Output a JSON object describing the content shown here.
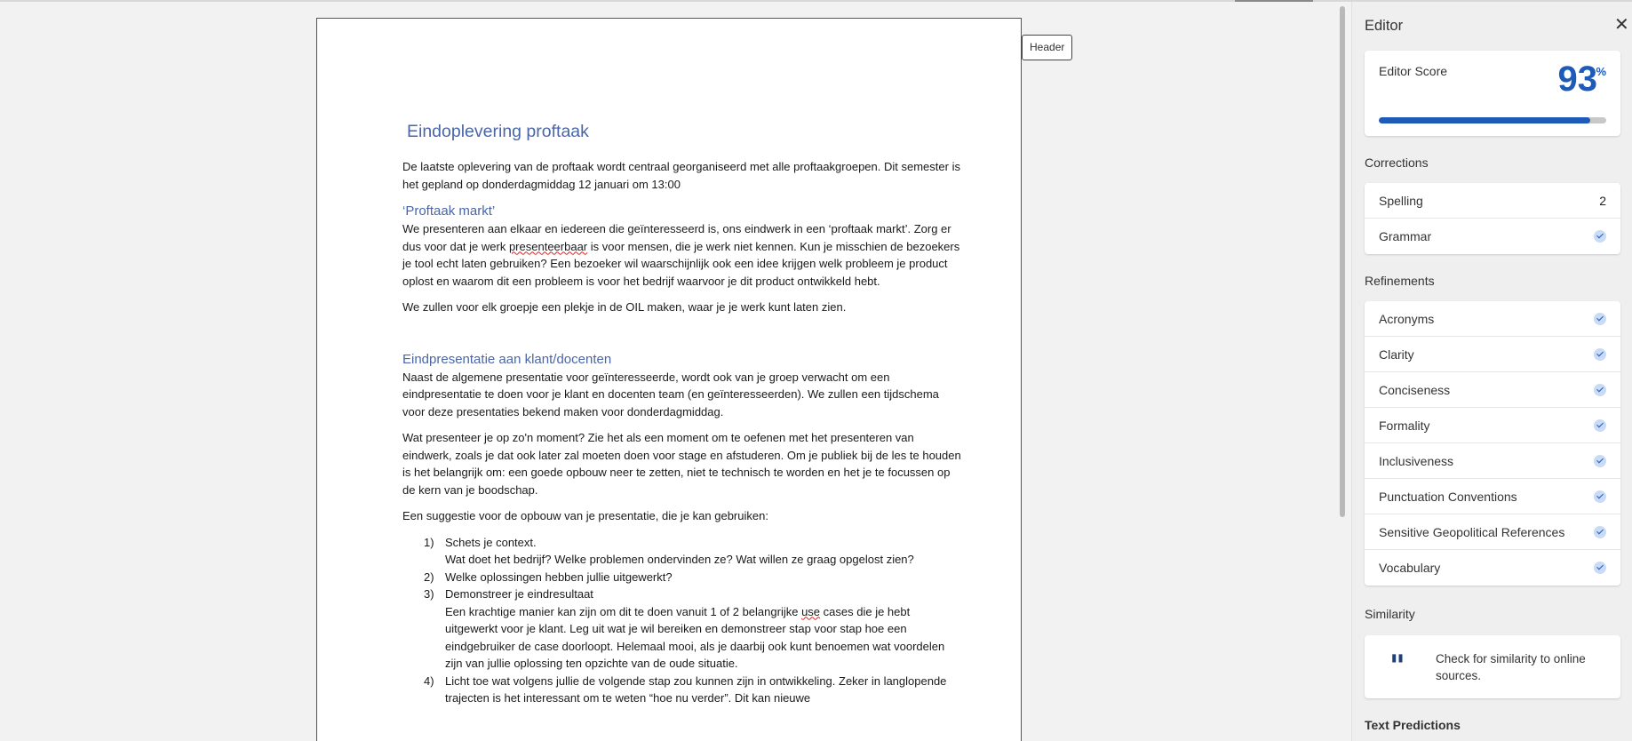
{
  "document": {
    "header_tag": "Header",
    "title": "Eindoplevering proftaak",
    "intro": "De laatste oplevering van de proftaak wordt centraal georganiseerd met alle proftaakgroepen. Dit semester is het gepland op donderdagmiddag 12 januari om 13:00",
    "section1_heading": "‘Proftaak markt’",
    "section1_p1_a": "We presenteren aan elkaar en iedereen die geïnteresseerd is, ons eindwerk in een ‘proftaak markt’. Zorg er dus voor dat je werk ",
    "section1_p1_misspelled": "presenteerbaar",
    "section1_p1_b": " is voor mensen, die je werk niet kennen. Kun je misschien de bezoekers je tool echt laten gebruiken? Een bezoeker wil waarschijnlijk ook een idee krijgen welk probleem je product oplost en waarom dit een probleem is voor het bedrijf waarvoor je dit product ontwikkeld hebt.",
    "section1_p2": "We zullen voor elk groepje een plekje in de OIL maken, waar je je werk kunt laten zien.",
    "section2_heading": "Eindpresentatie aan klant/docenten",
    "section2_p1": "Naast de algemene presentatie voor geïnteresseerde, wordt ook van je groep verwacht om een eindpresentatie te doen voor je klant en docenten team (en geïnteresseerden). We zullen een tijdschema voor deze presentaties bekend maken voor donderdagmiddag.",
    "section2_p2": "Wat presenteer je op zo'n moment? Zie het als een moment om te oefenen met het presenteren van eindwerk, zoals je dat ook later zal moeten doen voor stage en afstuderen. Om je publiek bij de les te houden is het belangrijk om: een goede opbouw neer te zetten, niet te technisch te worden en het je te focussen op de kern van je boodschap.",
    "section2_p3": "Een suggestie voor de opbouw van je presentatie, die je kan gebruiken:",
    "list": [
      {
        "num": "1)",
        "text": "Schets je context.",
        "sub": "Wat doet het bedrijf? Welke problemen ondervinden ze? Wat willen ze graag opgelost zien?"
      },
      {
        "num": "2)",
        "text": "Welke oplossingen hebben jullie uitgewerkt?",
        "sub": ""
      },
      {
        "num": "3)",
        "text": "Demonstreer je eindresultaat",
        "sub_a": "Een krachtige manier kan zijn om dit te doen vanuit 1 of 2 belangrijke ",
        "sub_misspelled": "use",
        "sub_b": " cases die je hebt uitgewerkt voor je klant. Leg uit wat je wil bereiken en demonstreer stap voor stap hoe een eindgebruiker de case doorloopt. Helemaal mooi, als je daarbij ook kunt benoemen wat voordelen zijn van jullie oplossing ten opzichte van de oude situatie."
      },
      {
        "num": "4)",
        "text": "Licht toe wat volgens jullie de volgende stap zou kunnen zijn in ontwikkeling. Zeker in langlopende trajecten is het interessant om te weten “hoe nu verder”. Dit kan nieuwe"
      }
    ]
  },
  "editor": {
    "title": "Editor",
    "close_icon": "close-icon",
    "score_label": "Editor Score",
    "score_value": "93",
    "score_unit": "%",
    "score_fraction": 0.93,
    "corrections_label": "Corrections",
    "corrections": [
      {
        "label": "Spelling",
        "count": "2"
      },
      {
        "label": "Grammar",
        "count": ""
      }
    ],
    "refinements_label": "Refinements",
    "refinements": [
      {
        "label": "Acronyms"
      },
      {
        "label": "Clarity"
      },
      {
        "label": "Conciseness"
      },
      {
        "label": "Formality"
      },
      {
        "label": "Inclusiveness"
      },
      {
        "label": "Punctuation Conventions"
      },
      {
        "label": "Sensitive Geopolitical References"
      },
      {
        "label": "Vocabulary"
      }
    ],
    "similarity_label": "Similarity",
    "similarity_text": "Check for similarity to online sources.",
    "text_predictions_label": "Text Predictions",
    "accent_color": "#1e5bb8"
  }
}
